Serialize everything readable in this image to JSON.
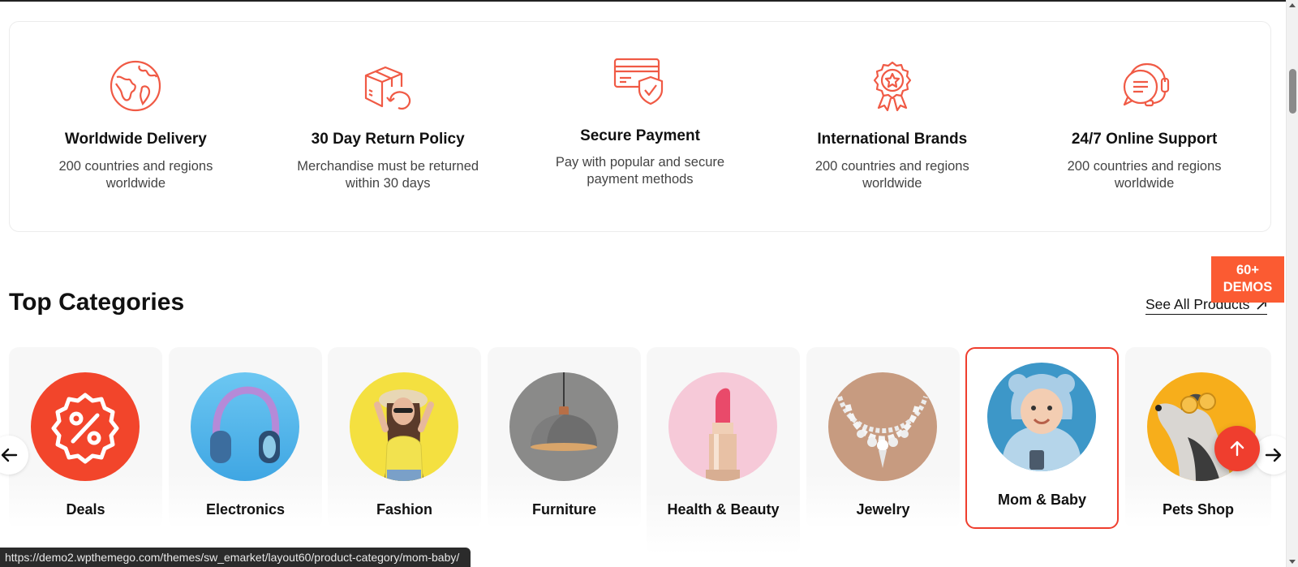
{
  "features": [
    {
      "title": "Worldwide Delivery",
      "desc": "200 countries and regions worldwide",
      "icon": "globe-icon"
    },
    {
      "title": "30 Day Return Policy",
      "desc": "Merchandise must be returned within 30 days",
      "icon": "box-return-icon"
    },
    {
      "title": "Secure Payment",
      "desc": "Pay with popular and secure payment methods",
      "icon": "card-shield-icon"
    },
    {
      "title": "International Brands",
      "desc": "200 countries and regions worldwide",
      "icon": "award-badge-icon"
    },
    {
      "title": "24/7 Online Support",
      "desc": "200 countries and regions worldwide",
      "icon": "headset-chat-icon"
    }
  ],
  "categories_section": {
    "title": "Top Categories",
    "see_all": "See All Products"
  },
  "demos_badge": {
    "line1": "60+",
    "line2": "DEMOS"
  },
  "categories": [
    {
      "label": "Deals"
    },
    {
      "label": "Electronics"
    },
    {
      "label": "Fashion"
    },
    {
      "label": "Furniture"
    },
    {
      "label": "Health & Beauty"
    },
    {
      "label": "Jewelry"
    },
    {
      "label": "Mom & Baby"
    },
    {
      "label": "Pets Shop"
    }
  ],
  "status_bar": {
    "url": "https://demo2.wpthemego.com/themes/sw_emarket/layout60/product-category/mom-baby/"
  },
  "colors": {
    "accent": "#ef3e2e",
    "badge": "#fb5b32",
    "icon": "#f05a45"
  }
}
